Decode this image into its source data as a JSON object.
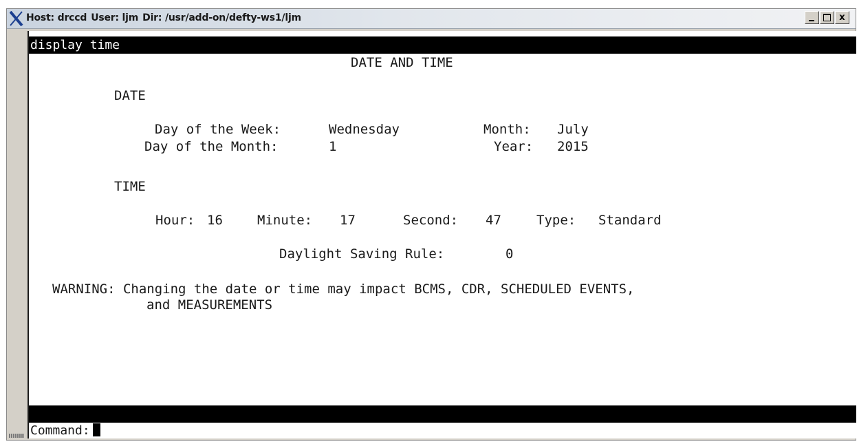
{
  "titlebar": {
    "host": "Host: drccd",
    "user": "User: ljm",
    "dir": "Dir: /usr/add-on/defty-ws1/ljm",
    "minimize": "_",
    "maximize": "",
    "close": "x"
  },
  "terminal": {
    "command_echo": "display time",
    "heading": "DATE AND TIME",
    "date_section": "DATE",
    "day_of_week_label": "Day of the Week:",
    "day_of_week": "Wednesday",
    "month_label": "Month:",
    "month": "July",
    "day_of_month_label": "Day of the Month:",
    "day_of_month": "1",
    "year_label": "Year:",
    "year": "2015",
    "time_section": "TIME",
    "hour_label": "Hour:",
    "hour": "16",
    "minute_label": "Minute:",
    "minute": "17",
    "second_label": "Second:",
    "second": "47",
    "type_label": "Type:",
    "type": "Standard",
    "dst_label": "Daylight Saving Rule:",
    "dst": "0",
    "warning_line1": "WARNING: Changing the date or time may impact BCMS, CDR, SCHEDULED EVENTS,",
    "warning_line2": "and MEASUREMENTS",
    "command_prompt": "Command:",
    "command_value": ""
  }
}
